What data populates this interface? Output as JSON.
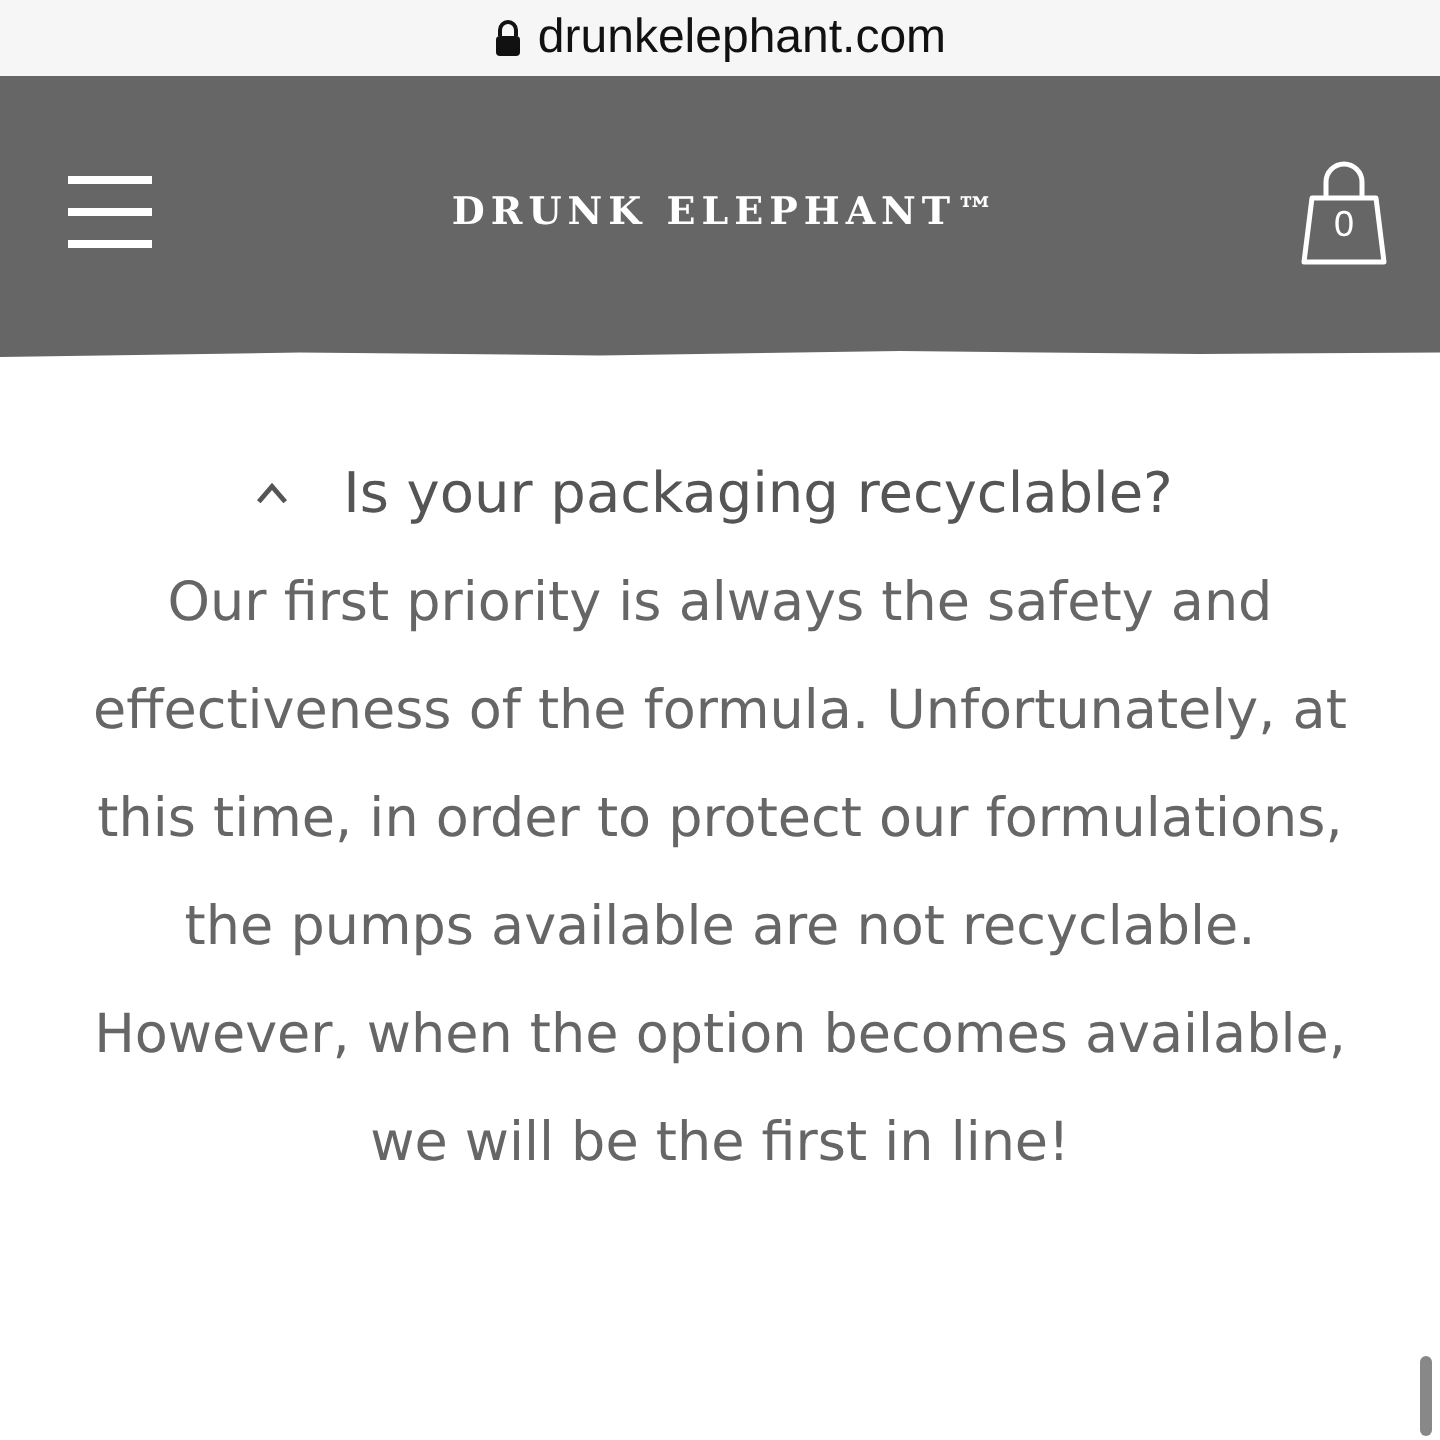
{
  "browser_bar": {
    "url": "drunkelephant.com"
  },
  "header": {
    "logo": "DRUNK ELEPHANT™",
    "cart_count": "0"
  },
  "faq": {
    "question": "Is your packaging recyclable?",
    "expanded": true,
    "answer": "Our first priority is always the safety and effectiveness of the formula. Unfortunately, at this time, in order to protect our formulations, the pumps available are not recyclable. However, when the option becomes available, we will be the first in line!"
  }
}
